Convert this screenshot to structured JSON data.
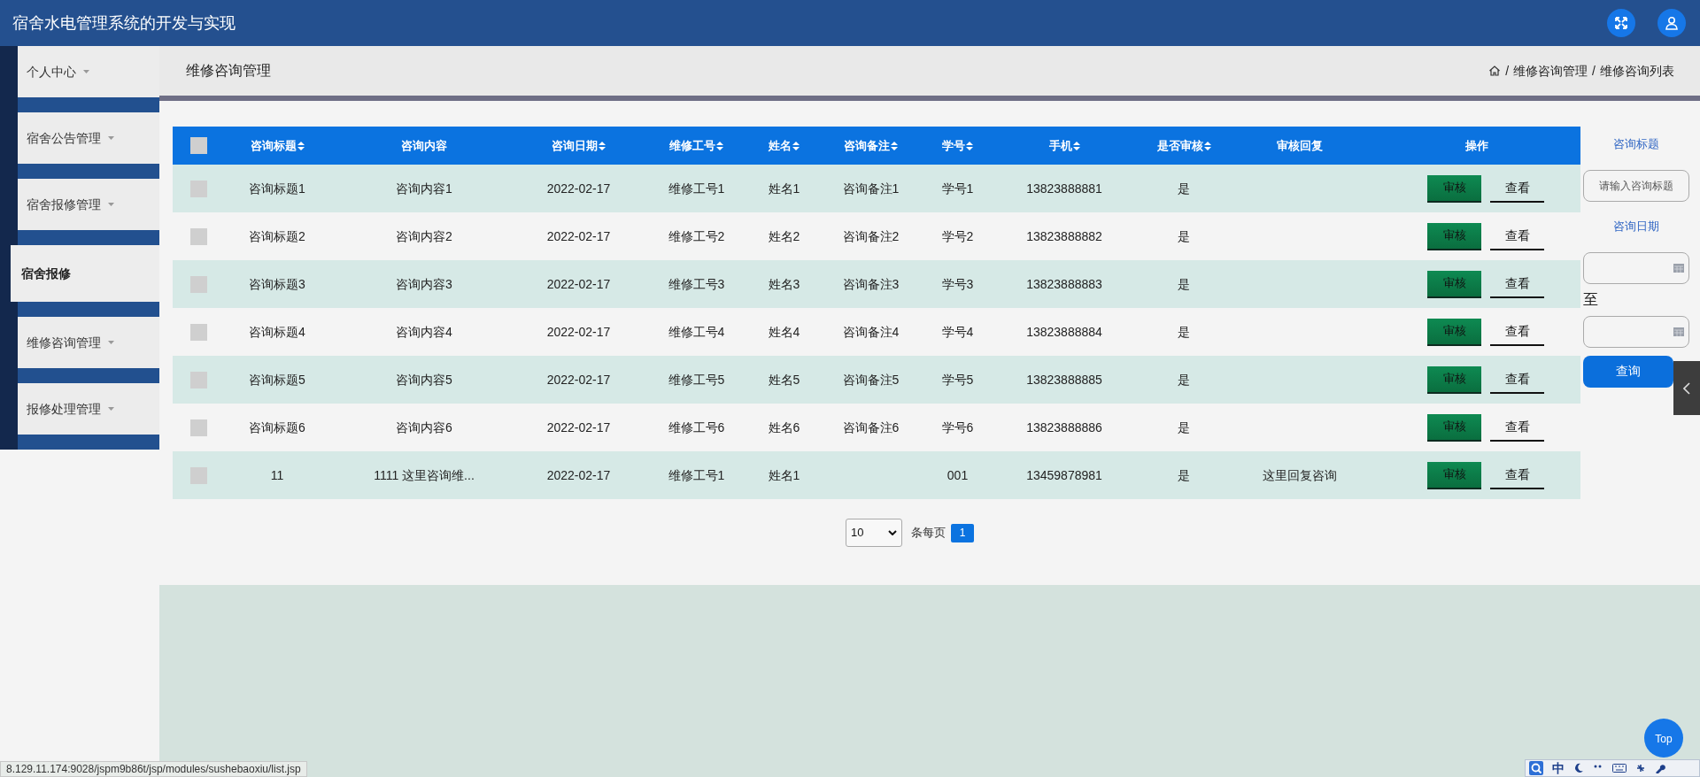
{
  "header": {
    "title": "宿舍水电管理系统的开发与实现"
  },
  "sidebar": {
    "items": [
      {
        "label": "个人中心",
        "selected": false,
        "expandable": true
      },
      {
        "label": "宿舍公告管理",
        "selected": false,
        "expandable": true
      },
      {
        "label": "宿舍报修管理",
        "selected": false,
        "expandable": true
      },
      {
        "label": "宿舍报修",
        "selected": true,
        "expandable": false
      },
      {
        "label": "维修咨询管理",
        "selected": false,
        "expandable": true
      },
      {
        "label": "报修处理管理",
        "selected": false,
        "expandable": true
      }
    ]
  },
  "page_title": "维修咨询管理",
  "breadcrumb": {
    "separator": "/",
    "items": [
      "维修咨询管理",
      "维修咨询列表"
    ]
  },
  "table": {
    "select_all": {
      "checked": false
    },
    "columns": [
      {
        "label": "咨询标题",
        "sortable": true
      },
      {
        "label": "咨询内容",
        "sortable": false
      },
      {
        "label": "咨询日期",
        "sortable": true
      },
      {
        "label": "维修工号",
        "sortable": true
      },
      {
        "label": "姓名",
        "sortable": true
      },
      {
        "label": "咨询备注",
        "sortable": true
      },
      {
        "label": "学号",
        "sortable": true
      },
      {
        "label": "手机",
        "sortable": true
      },
      {
        "label": "是否审核",
        "sortable": true
      },
      {
        "label": "审核回复",
        "sortable": false
      },
      {
        "label": "操作",
        "sortable": false
      }
    ],
    "rows": [
      {
        "checked": false,
        "cells": [
          "咨询标题1",
          "咨询内容1",
          "2022-02-17",
          "维修工号1",
          "姓名1",
          "咨询备注1",
          "学号1",
          "13823888881",
          "是",
          ""
        ],
        "actions": [
          "审核",
          "查看"
        ]
      },
      {
        "checked": false,
        "cells": [
          "咨询标题2",
          "咨询内容2",
          "2022-02-17",
          "维修工号2",
          "姓名2",
          "咨询备注2",
          "学号2",
          "13823888882",
          "是",
          ""
        ],
        "actions": [
          "审核",
          "查看"
        ]
      },
      {
        "checked": false,
        "cells": [
          "咨询标题3",
          "咨询内容3",
          "2022-02-17",
          "维修工号3",
          "姓名3",
          "咨询备注3",
          "学号3",
          "13823888883",
          "是",
          ""
        ],
        "actions": [
          "审核",
          "查看"
        ]
      },
      {
        "checked": false,
        "cells": [
          "咨询标题4",
          "咨询内容4",
          "2022-02-17",
          "维修工号4",
          "姓名4",
          "咨询备注4",
          "学号4",
          "13823888884",
          "是",
          ""
        ],
        "actions": [
          "审核",
          "查看"
        ]
      },
      {
        "checked": false,
        "cells": [
          "咨询标题5",
          "咨询内容5",
          "2022-02-17",
          "维修工号5",
          "姓名5",
          "咨询备注5",
          "学号5",
          "13823888885",
          "是",
          ""
        ],
        "actions": [
          "审核",
          "查看"
        ]
      },
      {
        "checked": false,
        "cells": [
          "咨询标题6",
          "咨询内容6",
          "2022-02-17",
          "维修工号6",
          "姓名6",
          "咨询备注6",
          "学号6",
          "13823888886",
          "是",
          ""
        ],
        "actions": [
          "审核",
          "查看"
        ]
      },
      {
        "checked": false,
        "cells": [
          "11",
          "1111 这里咨询维...",
          "2022-02-17",
          "维修工号1",
          "姓名1",
          "",
          "001",
          "13459878981",
          "是",
          "这里回复咨询"
        ],
        "actions": [
          "审核",
          "查看"
        ]
      }
    ]
  },
  "pagination": {
    "page_size": "10",
    "page_size_label": "条每页",
    "pages": [
      {
        "label": "1",
        "selected": true
      }
    ]
  },
  "filter": {
    "title_label": "咨询标题",
    "title_placeholder": "请输入咨询标题",
    "date_label": "咨询日期",
    "range_separator": "至",
    "search_button": "查询"
  },
  "back_to_top": "Top",
  "status_url": "8.129.11.174:9028/jspm9b86t/jsp/modules/sushebaoxiu/list.jsp",
  "ime_toolbar": {
    "mode": "中"
  }
}
